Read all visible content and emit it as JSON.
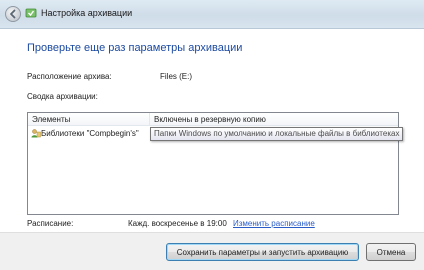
{
  "window": {
    "title": "Настройка архивации"
  },
  "heading": "Проверьте еще раз параметры архивации",
  "location": {
    "label": "Расположение архива:",
    "value": "Files (E:)"
  },
  "summary": {
    "label": "Сводка архивации:"
  },
  "table": {
    "columns": [
      "Элементы",
      "Включены в резервную копию"
    ],
    "rows": [
      {
        "item": "Библиотеки \"Compbegin's\""
      }
    ],
    "tooltip": "Папки Windows по умолчанию и локальные файлы в библиотеках"
  },
  "schedule": {
    "label": "Расписание:",
    "value": "Кажд. воскресенье в 19:00",
    "change_link": "Изменить расписание"
  },
  "buttons": {
    "save_run": "Сохранить параметры и запустить архивацию",
    "cancel": "Отмена"
  },
  "colors": {
    "heading": "#1c4aa0",
    "link": "#2a5cc8"
  },
  "icons": {
    "back": "back-arrow-icon",
    "app": "backup-app-icon",
    "library": "user-library-icon"
  }
}
